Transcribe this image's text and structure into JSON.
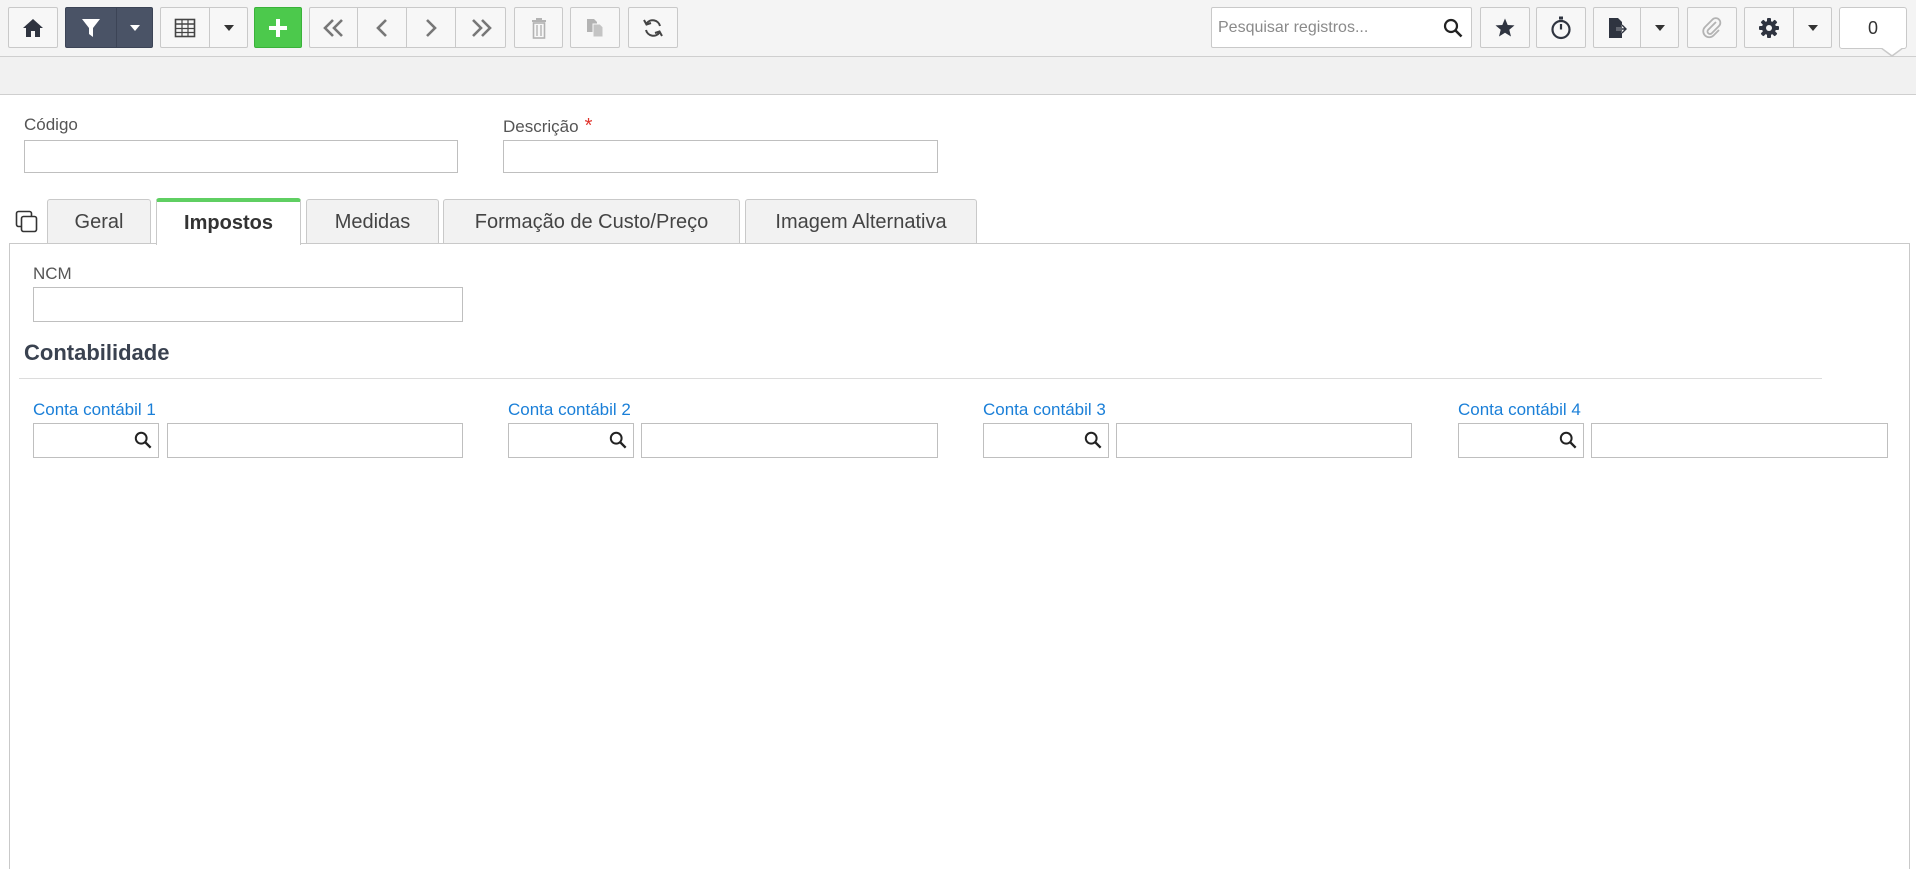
{
  "toolbar": {
    "home_icon": "home-icon",
    "filter_icon": "filter-icon",
    "grid_icon": "table-grid-icon",
    "add_icon": "plus-icon",
    "first_icon": "double-chevron-left-icon",
    "prev_icon": "chevron-left-icon",
    "next_icon": "chevron-right-icon",
    "last_icon": "double-chevron-right-icon",
    "delete_icon": "trash-icon",
    "copy_icon": "copy-icon",
    "refresh_icon": "refresh-icon",
    "search_placeholder": "Pesquisar registros...",
    "favorite_icon": "star-icon",
    "timer_icon": "stopwatch-icon",
    "export_icon": "export-document-icon",
    "attach_icon": "paperclip-icon",
    "settings_icon": "gear-icon",
    "counter": "0"
  },
  "form": {
    "codigo_label": "Código",
    "codigo_value": "",
    "descricao_label": "Descrição",
    "descricao_required": "*",
    "descricao_value": ""
  },
  "tabs": [
    {
      "label": "Geral",
      "active": false
    },
    {
      "label": "Impostos",
      "active": true
    },
    {
      "label": "Medidas",
      "active": false
    },
    {
      "label": "Formação de Custo/Preço",
      "active": false
    },
    {
      "label": "Imagem Alternativa",
      "active": false
    }
  ],
  "impostos": {
    "ncm_label": "NCM",
    "ncm_value": "",
    "section_title": "Contabilidade",
    "contas": [
      {
        "label": "Conta contábil 1",
        "code": "",
        "description": ""
      },
      {
        "label": "Conta contábil 2",
        "code": "",
        "description": ""
      },
      {
        "label": "Conta contábil 3",
        "code": "",
        "description": ""
      },
      {
        "label": "Conta contábil 4",
        "code": "",
        "description": ""
      }
    ]
  },
  "colors": {
    "accent_green": "#4cc94c",
    "active_tab_border": "#5fcf62",
    "dark_button": "#4a5366",
    "link_blue": "#1a7fd8",
    "required_red": "#e0332b"
  }
}
